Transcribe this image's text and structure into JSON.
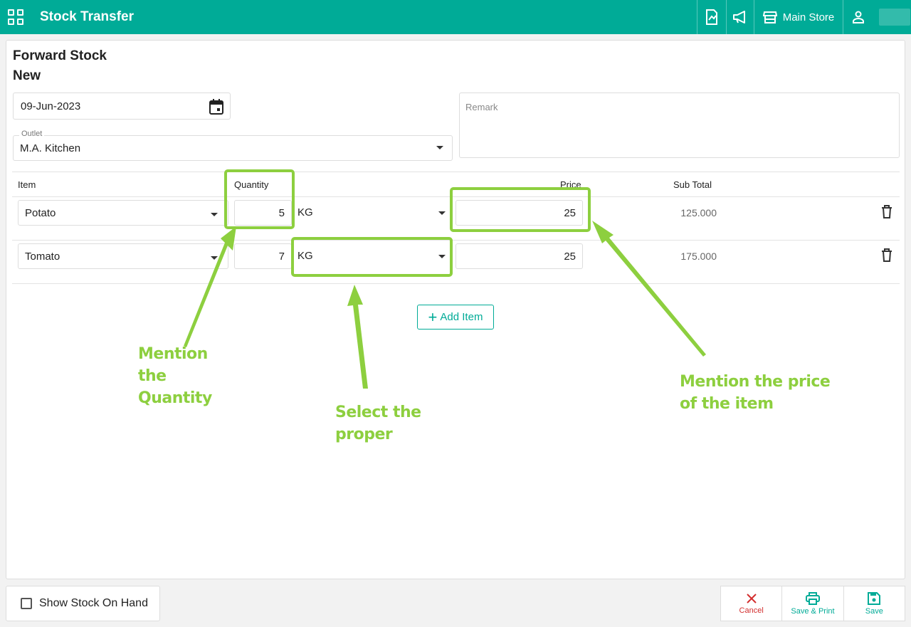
{
  "topbar": {
    "title": "Stock Transfer",
    "store": "Main Store",
    "icons": [
      "grid-icon",
      "report-icon",
      "megaphone-icon",
      "store-icon",
      "user-icon"
    ]
  },
  "form": {
    "heading": "Forward Stock",
    "status": "New",
    "date": "09-Jun-2023",
    "outlet_label": "Outlet",
    "outlet_value": "M.A. Kitchen",
    "remark_placeholder": "Remark"
  },
  "table": {
    "headers": {
      "item": "Item",
      "quantity": "Quantity",
      "price": "Price",
      "subtotal": "Sub Total"
    },
    "rows": [
      {
        "item": "Potato",
        "quantity": "5",
        "unit": "KG",
        "price": "25",
        "subtotal": "125.000"
      },
      {
        "item": "Tomato",
        "quantity": "7",
        "unit": "KG",
        "price": "25",
        "subtotal": "175.000"
      }
    ]
  },
  "add_item_label": "Add Item",
  "footer": {
    "show_stock_label": "Show Stock On Hand",
    "cancel_label": "Cancel",
    "save_print_label": "Save & Print",
    "save_label": "Save"
  },
  "annotations": {
    "quantity": [
      "Mention",
      "the",
      "Quantity"
    ],
    "unit": [
      "Select the",
      "proper"
    ],
    "price": [
      "Mention the price",
      "of the item"
    ]
  },
  "colors": {
    "primary": "#00ab97",
    "annotation": "#8dcf3f",
    "cancel": "#d32f2f"
  }
}
